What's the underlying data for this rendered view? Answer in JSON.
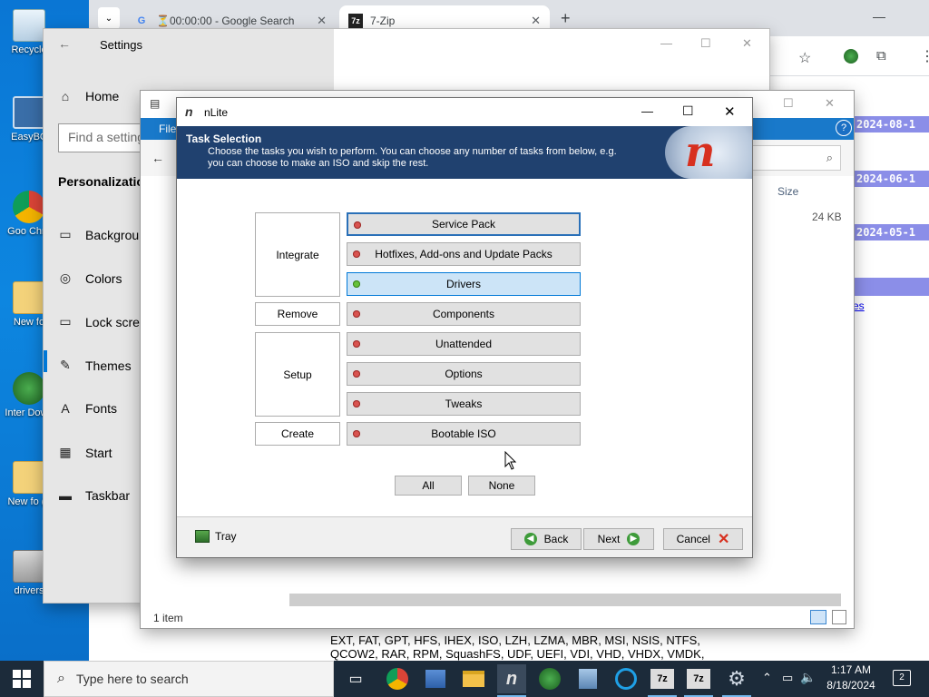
{
  "desktop": {
    "icons": [
      {
        "label": "Recycle",
        "icon": "recycle-bin-icon"
      },
      {
        "label": "EasyBC",
        "icon": "easybcd-icon"
      },
      {
        "label": "Goo Chro",
        "icon": "chrome-icon"
      },
      {
        "label": "New fo",
        "icon": "folder-icon"
      },
      {
        "label": "Inter Down",
        "icon": "idm-icon"
      },
      {
        "label": "New fo (2",
        "icon": "folder-icon"
      },
      {
        "label": "drivers",
        "icon": "drivers-icon"
      }
    ]
  },
  "browser": {
    "tabs": [
      {
        "title": "⏳00:00:00 - Google Search",
        "icon": "google-icon"
      },
      {
        "title": "7-Zip",
        "icon": "7zip-icon"
      }
    ],
    "page": {
      "date_badges": [
        "2024-08-1",
        "2024-06-1",
        "2024-05-1"
      ],
      "link_text": "es",
      "body_lines": [
        "EXT, FAT, GPT, HFS, IHEX, ISO, LZH, LZMA, MBR, MSI, NSIS, NTFS,",
        "QCOW2, RAR, RPM, SquashFS, UDF, UEFI, VDI, VHD, VHDX, VMDK,"
      ],
      "heading_fragment": "Th"
    }
  },
  "settings": {
    "title": "Settings",
    "home": "Home",
    "search_placeholder": "Find a setting",
    "section": "Personalization",
    "items": [
      {
        "label": "Background",
        "icon": "image-icon"
      },
      {
        "label": "Colors",
        "icon": "palette-icon"
      },
      {
        "label": "Lock screen",
        "icon": "lock-screen-icon"
      },
      {
        "label": "Themes",
        "icon": "themes-icon",
        "active": true
      },
      {
        "label": "Fonts",
        "icon": "fonts-icon"
      },
      {
        "label": "Start",
        "icon": "start-icon"
      },
      {
        "label": "Taskbar",
        "icon": "taskbar-icon"
      }
    ]
  },
  "explorer": {
    "ribbon_tab": "File",
    "column_size": "Size",
    "file_size": "24 KB",
    "status": "1 item"
  },
  "nlite": {
    "title": "nLite",
    "header_title": "Task Selection",
    "header_text_1": "Choose the tasks you wish to perform. You can choose any number of tasks from below, e.g.",
    "header_text_2": "you can choose to make an ISO and skip the rest.",
    "groups": {
      "integrate": "Integrate",
      "remove": "Remove",
      "setup": "Setup",
      "create": "Create"
    },
    "tasks": [
      {
        "label": "Service Pack",
        "state": "off",
        "focus": true
      },
      {
        "label": "Hotfixes, Add-ons and Update Packs",
        "state": "off"
      },
      {
        "label": "Drivers",
        "state": "on"
      },
      {
        "label": "Components",
        "state": "off"
      },
      {
        "label": "Unattended",
        "state": "off"
      },
      {
        "label": "Options",
        "state": "off"
      },
      {
        "label": "Tweaks",
        "state": "off"
      },
      {
        "label": "Bootable ISO",
        "state": "off"
      }
    ],
    "all": "All",
    "none": "None",
    "tray": "Tray",
    "back": "Back",
    "next": "Next",
    "cancel": "Cancel"
  },
  "taskbar": {
    "search_placeholder": "Type here to search",
    "time": "1:17 AM",
    "date": "8/18/2024",
    "notification_count": "2",
    "apps": [
      "task-view-icon",
      "chrome-icon",
      "network-app-icon",
      "file-explorer-icon",
      "nlite-icon",
      "idm-icon",
      "setup-icon",
      "edge-icon",
      "7zip-icon",
      "7zip-icon",
      "settings-gear-icon"
    ]
  }
}
